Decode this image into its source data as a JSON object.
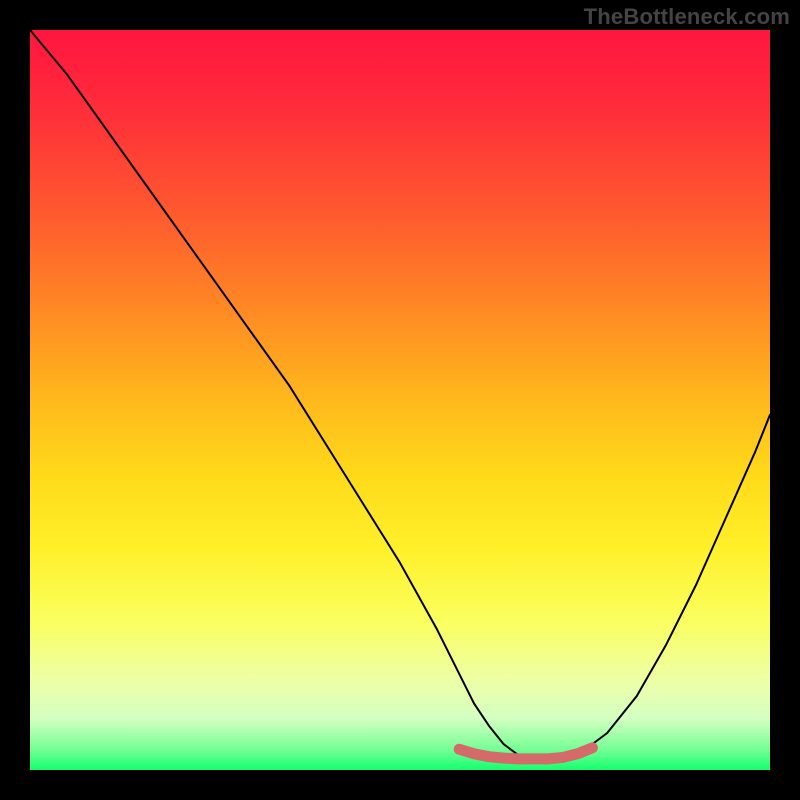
{
  "watermark": "TheBottleneck.com",
  "chart_data": {
    "type": "line",
    "title": "",
    "xlabel": "",
    "ylabel": "",
    "xlim": [
      0,
      100
    ],
    "ylim": [
      0,
      100
    ],
    "series": [
      {
        "name": "black-curve",
        "x": [
          0,
          5,
          10,
          15,
          20,
          25,
          30,
          35,
          40,
          45,
          50,
          55,
          58,
          60,
          62,
          64,
          66,
          68,
          70,
          72,
          74,
          78,
          82,
          86,
          90,
          94,
          98,
          100
        ],
        "y": [
          100,
          94,
          87,
          80,
          73,
          66,
          59,
          52,
          44,
          36,
          28,
          19,
          13,
          9,
          6,
          3.5,
          2,
          1.5,
          1.5,
          1.5,
          2,
          5,
          10,
          17,
          25,
          34,
          43,
          48
        ]
      },
      {
        "name": "bottom-red-highlight",
        "x": [
          58,
          60,
          62,
          64,
          66,
          68,
          70,
          72,
          74,
          76
        ],
        "y": [
          2.8,
          2.2,
          1.8,
          1.6,
          1.5,
          1.5,
          1.5,
          1.7,
          2.2,
          3.0
        ]
      }
    ],
    "highlight_color": "#d46a6a",
    "curve_color": "#000000",
    "gradient_stops": [
      {
        "pos": 0.0,
        "color": "#ff163f"
      },
      {
        "pos": 0.25,
        "color": "#ff5a2e"
      },
      {
        "pos": 0.5,
        "color": "#ffb81c"
      },
      {
        "pos": 0.7,
        "color": "#fff02a"
      },
      {
        "pos": 0.88,
        "color": "#edffa6"
      },
      {
        "pos": 1.0,
        "color": "#14ff6e"
      }
    ]
  }
}
